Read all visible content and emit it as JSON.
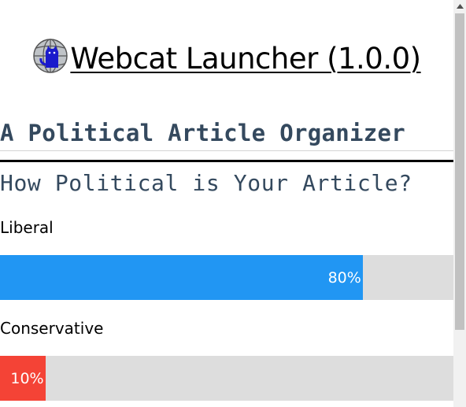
{
  "header": {
    "logo_icon": "globe-cat-icon",
    "title": "Webcat Launcher (1.0.0)"
  },
  "subtitle": "A Political Article Organizer",
  "question": "How Political is Your Article?",
  "bars": [
    {
      "label": "Liberal",
      "percent": 80,
      "percent_text": "80%",
      "color": "#2196f3"
    },
    {
      "label": "Conservative",
      "percent": 10,
      "percent_text": "10%",
      "color": "#f44336"
    }
  ],
  "colors": {
    "heading": "#34495e",
    "track": "#dddddd"
  }
}
